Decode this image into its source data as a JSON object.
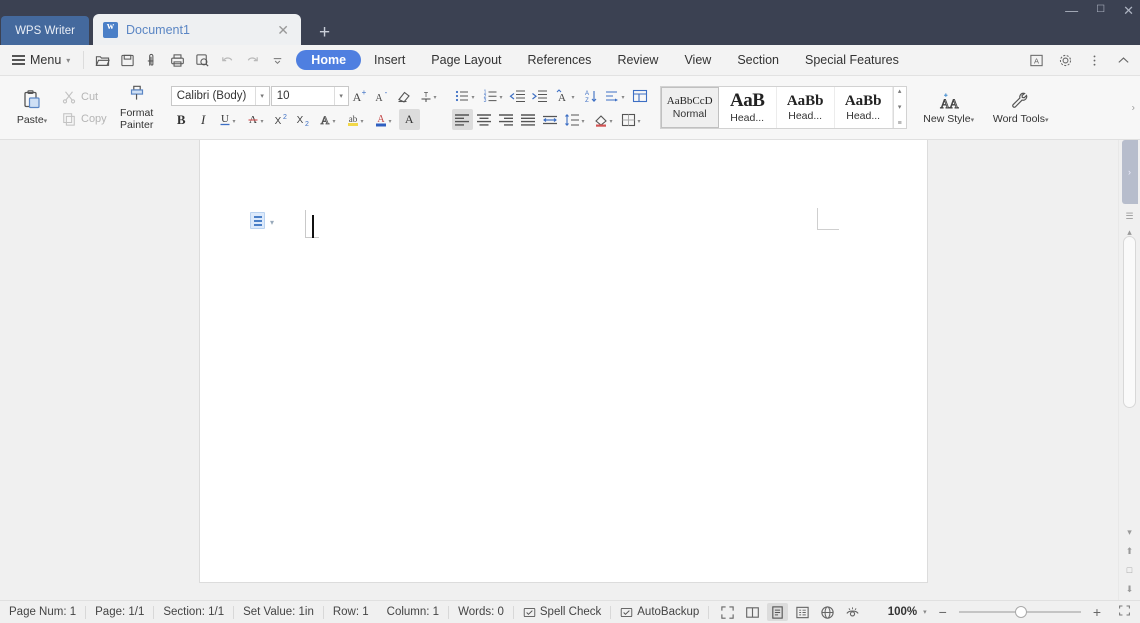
{
  "titlebar": {
    "app_badge": "WPS Writer",
    "tab": {
      "name": "Document1",
      "close": "✕",
      "icon": "wps-writer-file-icon"
    },
    "new_tab": "+",
    "window_controls": {
      "minimize": "—",
      "maximize": "☐",
      "close": "✕"
    },
    "bg_color": "#3b4152",
    "badge_color": "#44699d"
  },
  "menubar": {
    "menu_label": "Menu",
    "quick_access": [
      {
        "name": "open-icon",
        "title": "Open"
      },
      {
        "name": "save-icon",
        "title": "Save"
      },
      {
        "name": "save-as-icon",
        "title": "Save As"
      },
      {
        "name": "print-icon",
        "title": "Print"
      },
      {
        "name": "print-preview-icon",
        "title": "Print Preview"
      },
      {
        "name": "undo-icon",
        "title": "Undo"
      },
      {
        "name": "redo-icon",
        "title": "Redo"
      },
      {
        "name": "customize-quick-access-icon",
        "title": "Customize"
      }
    ],
    "tabs": [
      {
        "label": "Home",
        "active": true
      },
      {
        "label": "Insert",
        "active": false
      },
      {
        "label": "Page Layout",
        "active": false
      },
      {
        "label": "References",
        "active": false
      },
      {
        "label": "Review",
        "active": false
      },
      {
        "label": "View",
        "active": false
      },
      {
        "label": "Section",
        "active": false
      },
      {
        "label": "Special Features",
        "active": false
      }
    ],
    "active_tab_color": "#4f7fe0",
    "right_icons": [
      {
        "name": "document-mode-icon"
      },
      {
        "name": "gear-icon"
      },
      {
        "name": "more-options-icon"
      },
      {
        "name": "collapse-ribbon-icon"
      }
    ]
  },
  "ribbon": {
    "clipboard": {
      "paste": "Paste",
      "paste_arrow": "▾",
      "cut": "Cut",
      "copy": "Copy",
      "format_painter_line1": "Format",
      "format_painter_line2": "Painter"
    },
    "font": {
      "family_value": "Calibri (Body)",
      "size_value": "10",
      "buttons_row1": [
        {
          "name": "grow-font-icon",
          "glyph": "A⁺"
        },
        {
          "name": "shrink-font-icon",
          "glyph": "A⁻"
        },
        {
          "name": "clear-formatting-icon",
          "glyph": "◇"
        },
        {
          "name": "pinyin-guide-icon",
          "glyph": "ᴛₜ"
        }
      ],
      "buttons_row2": [
        {
          "name": "bold-button",
          "glyph": "B"
        },
        {
          "name": "italic-button",
          "glyph": "I"
        },
        {
          "name": "underline-button",
          "glyph": "U"
        },
        {
          "name": "strikethrough-button",
          "glyph": "A"
        },
        {
          "name": "superscript-button",
          "glyph": "X²"
        },
        {
          "name": "subscript-button",
          "glyph": "X₂"
        },
        {
          "name": "text-effects-button",
          "glyph": "A"
        },
        {
          "name": "highlight-color-button",
          "glyph": "ab"
        },
        {
          "name": "font-color-button",
          "glyph": "A"
        },
        {
          "name": "character-shading-button",
          "glyph": "A"
        }
      ]
    },
    "paragraph": {
      "buttons_row1": [
        {
          "name": "bullet-list-button",
          "glyph": "☰"
        },
        {
          "name": "numbered-list-button",
          "glyph": "☰"
        },
        {
          "name": "decrease-indent-button",
          "glyph": "⇤"
        },
        {
          "name": "increase-indent-button",
          "glyph": "⇥"
        },
        {
          "name": "asian-layout-button",
          "glyph": "A"
        },
        {
          "name": "sort-button",
          "glyph": "A↓"
        },
        {
          "name": "paragraph-layout-button",
          "glyph": "≡"
        },
        {
          "name": "show-formatting-marks-button",
          "glyph": "¶"
        }
      ],
      "buttons_row2": [
        {
          "name": "align-left-button",
          "glyph": "≡",
          "active": true
        },
        {
          "name": "align-center-button",
          "glyph": "≡",
          "active": false
        },
        {
          "name": "align-right-button",
          "glyph": "≡",
          "active": false
        },
        {
          "name": "justify-button",
          "glyph": "≡",
          "active": false
        },
        {
          "name": "distributed-button",
          "glyph": "≡",
          "active": false
        },
        {
          "name": "line-spacing-button",
          "glyph": "↕",
          "active": false
        },
        {
          "name": "shading-button",
          "glyph": "◇",
          "active": false
        },
        {
          "name": "borders-button",
          "glyph": "⊞",
          "active": false
        }
      ]
    },
    "styles": {
      "items": [
        {
          "preview": "AaBbCcD",
          "name": "Normal",
          "size": "small",
          "selected": true
        },
        {
          "preview": "AaB",
          "name": "Head...",
          "size": "big",
          "selected": false
        },
        {
          "preview": "AaBb",
          "name": "Head...",
          "size": "mid",
          "selected": false
        },
        {
          "preview": "AaBb",
          "name": "Head...",
          "size": "mid",
          "selected": false
        }
      ],
      "scroll_up": "▴",
      "scroll_down": "▾",
      "more": "≡"
    },
    "new_style": {
      "label": "New Style",
      "arrow": "▾",
      "icon": "new-style-icon"
    },
    "word_tools": {
      "label": "Word Tools",
      "arrow": "▾",
      "icon": "wrench-icon"
    },
    "expand_arrow": "›"
  },
  "document": {
    "page_background": "#ffffff",
    "paragraph_marker_icon": "paragraph-settings-icon",
    "paragraph_marker_caret": "▾",
    "cursor_visible": true
  },
  "right_rail": {
    "panel_tab": "›",
    "top_icons": [
      {
        "name": "scroll-page-up-icon",
        "glyph": "☰"
      },
      {
        "name": "scroll-up-icon",
        "glyph": "▴"
      }
    ],
    "bottom_icons": [
      {
        "name": "scroll-down-icon",
        "glyph": "▾"
      },
      {
        "name": "previous-page-icon",
        "glyph": "⬆"
      },
      {
        "name": "select-browse-object-icon",
        "glyph": "□"
      },
      {
        "name": "next-page-icon",
        "glyph": "⬇"
      }
    ]
  },
  "statusbar": {
    "items": [
      {
        "label": "Page Num: 1",
        "name": "status-page-num"
      },
      {
        "label": "Page: 1/1",
        "name": "status-page"
      },
      {
        "label": "Section: 1/1",
        "name": "status-section"
      },
      {
        "label": "Set Value: 1in",
        "name": "status-set-value"
      },
      {
        "label": "Row: 1",
        "name": "status-row"
      },
      {
        "label": "Column: 1",
        "name": "status-column"
      },
      {
        "label": "Words: 0",
        "name": "status-words"
      }
    ],
    "checks": [
      {
        "label": "Spell Check",
        "name": "status-spell-check"
      },
      {
        "label": "AutoBackup",
        "name": "status-autobackup"
      }
    ],
    "views": [
      {
        "name": "fullscreen-view-button",
        "active": false
      },
      {
        "name": "reading-view-button",
        "active": false
      },
      {
        "name": "print-layout-view-button",
        "active": true
      },
      {
        "name": "outline-view-button",
        "active": false
      },
      {
        "name": "web-layout-view-button",
        "active": false
      },
      {
        "name": "eye-protection-button",
        "active": false
      }
    ],
    "zoom": {
      "value": "100%",
      "arrow": "▾",
      "minus": "−",
      "plus": "+",
      "fit": "⬚",
      "slider_position_pct": 47
    }
  }
}
